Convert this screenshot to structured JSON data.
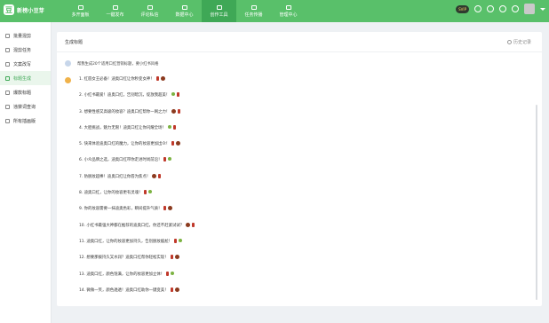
{
  "app": {
    "name": "新榜小豆芽",
    "logo_char": "豆"
  },
  "nav": [
    {
      "label": "多开面板",
      "active": false
    },
    {
      "label": "一键发布",
      "active": false
    },
    {
      "label": "评论私信",
      "active": false
    },
    {
      "label": "数据中心",
      "active": false
    },
    {
      "label": "创作工具",
      "active": true
    },
    {
      "label": "任务传播",
      "active": false
    },
    {
      "label": "管理中心",
      "active": false
    }
  ],
  "top_right": {
    "vip_label": "SVIP"
  },
  "sidebar": [
    {
      "label": "批量混剪",
      "active": false
    },
    {
      "label": "混剪任务",
      "active": false
    },
    {
      "label": "文案改写",
      "active": false
    },
    {
      "label": "标题生成",
      "active": true
    },
    {
      "label": "爆款标题",
      "active": false
    },
    {
      "label": "违禁词查询",
      "active": false
    },
    {
      "label": "所有插画版",
      "active": false
    }
  ],
  "panel": {
    "title": "生成标题",
    "history_label": "历史记录",
    "prompt": "帮我生成20个适用口红营销标题，要小红书风格",
    "results": [
      "1. 红唇女王必备！迪奥口红让你秒变女神！",
      "2. 小红书最爱！迪奥口红，告别暗沉，绽放我超美！",
      "3. 想要性感又高级的妆容？迪奥口红帮你一网之力！",
      "4. 大胆挑战，魅力无限！迪奥口红让你闪耀全场！",
      "5. 快来体验迪奥口红的魔力，让你的妆容更加出众！",
      "6. 小众品牌之选，迪奥口红带你走进时尚前沿！",
      "7. 防脱妆超棒！迪奥口红让你唇为焦点！",
      "8. 迪奥口红，让你的妆容更有灵魂！",
      "9. 你的妆容需要一抹迪奥色彩，瞬间提升气质！",
      "10. 小红书最强大神都在推荐的迪奥口红，你还不赶紧试试？",
      "11. 迪奥口红，让你的妆容更加持久，告别脱妆尴尬！",
      "12. 想要那拨持久又水润？迪奥口红帮你轻松实现！",
      "13. 迪奥口红，颜色饱满，让你的妆容更加立体！",
      "14. 微微一笑，颜色透透！迪奥口红助你一键变美！"
    ]
  },
  "colors": {
    "brand_green": "#59c06a",
    "active_green": "#3fa856"
  }
}
